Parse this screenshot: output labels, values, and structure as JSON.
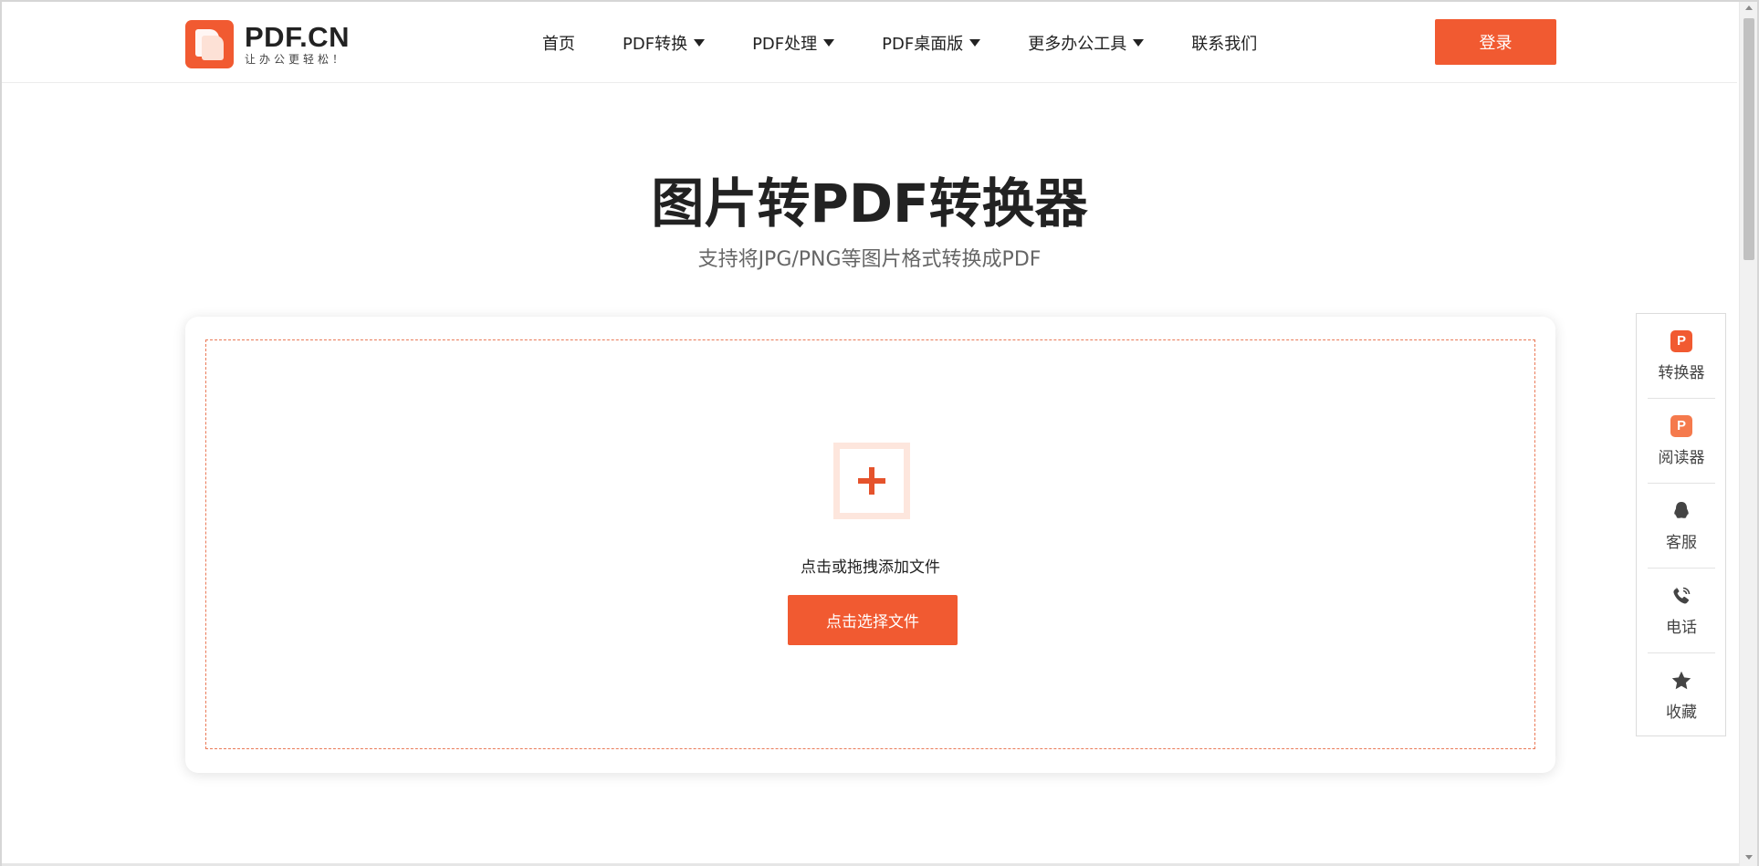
{
  "header": {
    "logo_name": "PDF.CN",
    "logo_slogan": "让办公更轻松！",
    "nav": [
      {
        "label": "首页",
        "dropdown": false
      },
      {
        "label": "PDF转换",
        "dropdown": true
      },
      {
        "label": "PDF处理",
        "dropdown": true
      },
      {
        "label": "PDF桌面版",
        "dropdown": true
      },
      {
        "label": "更多办公工具",
        "dropdown": true
      },
      {
        "label": "联系我们",
        "dropdown": false
      }
    ],
    "login_label": "登录"
  },
  "hero": {
    "title": "图片转PDF转换器",
    "subtitle": "支持将JPG/PNG等图片格式转换成PDF"
  },
  "upload": {
    "hint": "点击或拖拽添加文件",
    "button_label": "点击选择文件"
  },
  "sidebar": {
    "items": [
      {
        "label": "转换器",
        "icon": "pdf-converter-icon"
      },
      {
        "label": "阅读器",
        "icon": "pdf-reader-icon"
      },
      {
        "label": "客服",
        "icon": "qq-icon"
      },
      {
        "label": "电话",
        "icon": "phone-icon"
      },
      {
        "label": "收藏",
        "icon": "star-icon"
      }
    ]
  },
  "colors": {
    "accent": "#f15a31",
    "dash_border": "#ea7a58",
    "add_box_border": "#fde6dd"
  }
}
